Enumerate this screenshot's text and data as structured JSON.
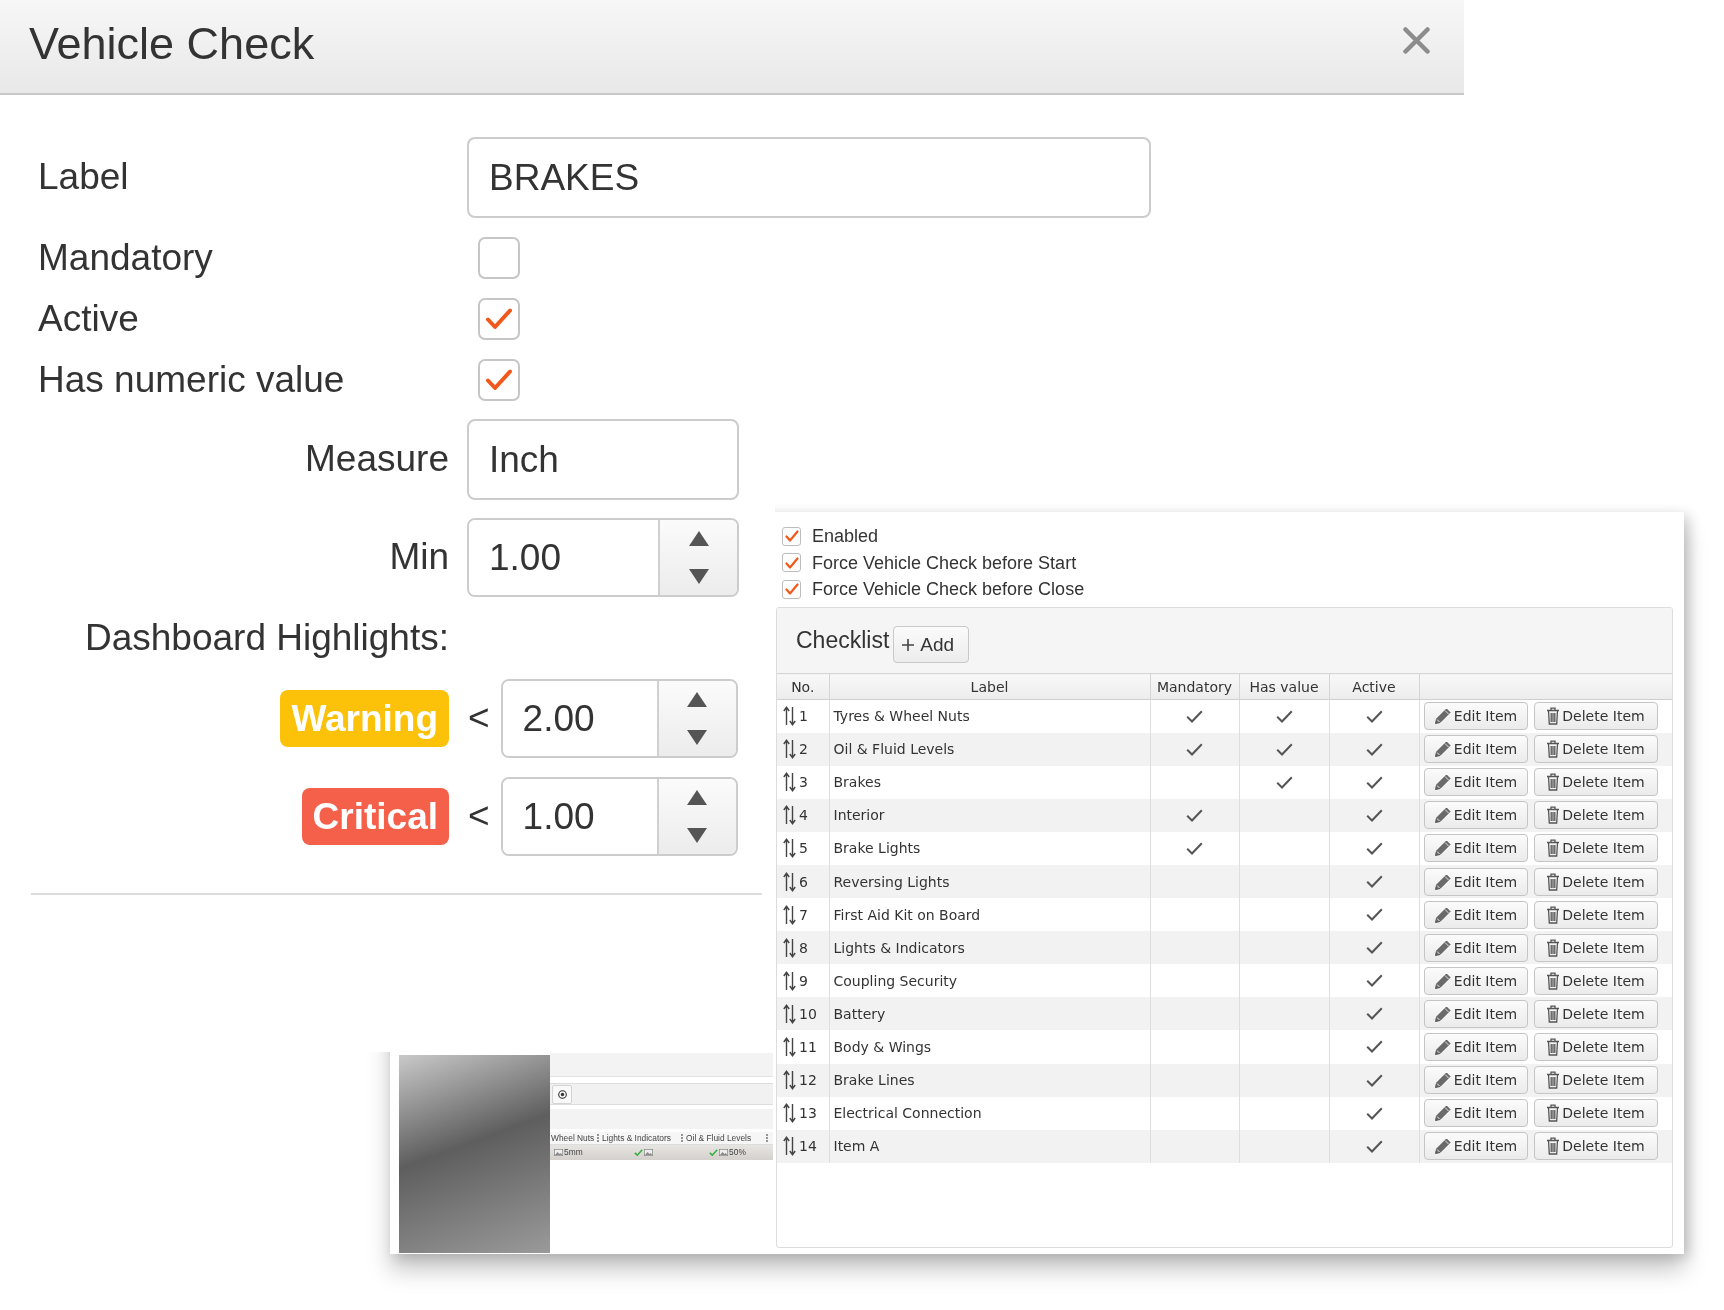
{
  "dialog": {
    "title": "Vehicle Check"
  },
  "form": {
    "label_field": {
      "label": "Label",
      "value": "BRAKES"
    },
    "checkboxes": [
      {
        "label": "Mandatory",
        "checked": false
      },
      {
        "label": "Active",
        "checked": true
      },
      {
        "label": "Has numeric value",
        "checked": true
      }
    ],
    "measure_field": {
      "label": "Measure",
      "value": "Inch"
    },
    "min_field": {
      "label": "Min",
      "value": "1.00"
    },
    "highlights": {
      "title": "Dashboard Highlights:",
      "thresholds": [
        {
          "label": "Warning",
          "color": "#fcc20a",
          "operator": "<",
          "value": "2.00"
        },
        {
          "label": "Critical",
          "color": "#f4604a",
          "operator": "<",
          "value": "1.00"
        }
      ]
    }
  },
  "settings": {
    "options": [
      {
        "label": "Enabled",
        "checked": true
      },
      {
        "label": "Force Vehicle Check before Start",
        "checked": true
      },
      {
        "label": "Force Vehicle Check before Close",
        "checked": true
      }
    ],
    "checklist": {
      "title": "Checklist",
      "add_button": "Add",
      "columns": [
        "No.",
        "Label",
        "Mandatory",
        "Has value",
        "Active"
      ],
      "rows": [
        {
          "no": "1",
          "label": "Tyres & Wheel Nuts",
          "mandatory": true,
          "has_value": true,
          "active": true,
          "edit_button": "Edit Item",
          "delete_button": "Delete Item"
        },
        {
          "no": "2",
          "label": "Oil & Fluid Levels",
          "mandatory": true,
          "has_value": true,
          "active": true,
          "edit_button": "Edit Item",
          "delete_button": "Delete Item"
        },
        {
          "no": "3",
          "label": "Brakes",
          "mandatory": false,
          "has_value": true,
          "active": true,
          "edit_button": "Edit Item",
          "delete_button": "Delete Item"
        },
        {
          "no": "4",
          "label": "Interior",
          "mandatory": true,
          "has_value": false,
          "active": true,
          "edit_button": "Edit Item",
          "delete_button": "Delete Item"
        },
        {
          "no": "5",
          "label": "Brake Lights",
          "mandatory": true,
          "has_value": false,
          "active": true,
          "edit_button": "Edit Item",
          "delete_button": "Delete Item"
        },
        {
          "no": "6",
          "label": "Reversing Lights",
          "mandatory": false,
          "has_value": false,
          "active": true,
          "edit_button": "Edit Item",
          "delete_button": "Delete Item"
        },
        {
          "no": "7",
          "label": "First Aid Kit on Board",
          "mandatory": false,
          "has_value": false,
          "active": true,
          "edit_button": "Edit Item",
          "delete_button": "Delete Item"
        },
        {
          "no": "8",
          "label": "Lights & Indicators",
          "mandatory": false,
          "has_value": false,
          "active": true,
          "edit_button": "Edit Item",
          "delete_button": "Delete Item"
        },
        {
          "no": "9",
          "label": "Coupling Security",
          "mandatory": false,
          "has_value": false,
          "active": true,
          "edit_button": "Edit Item",
          "delete_button": "Delete Item"
        },
        {
          "no": "10",
          "label": "Battery",
          "mandatory": false,
          "has_value": false,
          "active": true,
          "edit_button": "Edit Item",
          "delete_button": "Delete Item"
        },
        {
          "no": "11",
          "label": "Body & Wings",
          "mandatory": false,
          "has_value": false,
          "active": true,
          "edit_button": "Edit Item",
          "delete_button": "Delete Item"
        },
        {
          "no": "12",
          "label": "Brake Lines",
          "mandatory": false,
          "has_value": false,
          "active": true,
          "edit_button": "Edit Item",
          "delete_button": "Delete Item"
        },
        {
          "no": "13",
          "label": "Electrical Connection",
          "mandatory": false,
          "has_value": false,
          "active": true,
          "edit_button": "Edit Item",
          "delete_button": "Delete Item"
        },
        {
          "no": "14",
          "label": "Item A",
          "mandatory": false,
          "has_value": false,
          "active": true,
          "edit_button": "Edit Item",
          "delete_button": "Delete Item"
        }
      ]
    },
    "preview": {
      "columns": [
        {
          "header": "Wheel Nuts",
          "ticked": false,
          "value": "5mm"
        },
        {
          "header": "Lights & Indicators",
          "ticked": true
        },
        {
          "header": "Oil & Fluid Levels",
          "ticked": true,
          "value": "50%"
        }
      ]
    }
  }
}
